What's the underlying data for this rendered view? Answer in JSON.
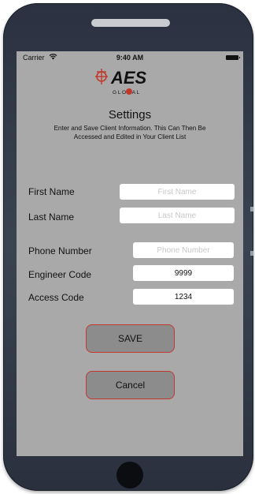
{
  "status_bar": {
    "carrier": "Carrier",
    "time": "9:40 AM"
  },
  "logo": {
    "main_text": "AES",
    "sub_text": "G L O B A L"
  },
  "header": {
    "title": "Settings",
    "subtitle_line1": "Enter and Save Client Information. This Can Then Be",
    "subtitle_line2": "Accessed and Edited in Your Client List"
  },
  "form": {
    "first_name": {
      "label": "First Name",
      "value": "",
      "placeholder": "First Name"
    },
    "last_name": {
      "label": "Last Name",
      "value": "",
      "placeholder": "Last Name"
    },
    "phone_number": {
      "label": "Phone Number",
      "value": "",
      "placeholder": "Phone Number"
    },
    "engineer_code": {
      "label": "Engineer Code",
      "value": "9999",
      "placeholder": ""
    },
    "access_code": {
      "label": "Access Code",
      "value": "1234",
      "placeholder": ""
    }
  },
  "buttons": {
    "save": "SAVE",
    "cancel": "Cancel"
  },
  "colors": {
    "screen_bg": "#a9a9a9",
    "button_bg": "#8c8c8c",
    "button_border": "#c0392b",
    "logo_red": "#c0392b"
  }
}
